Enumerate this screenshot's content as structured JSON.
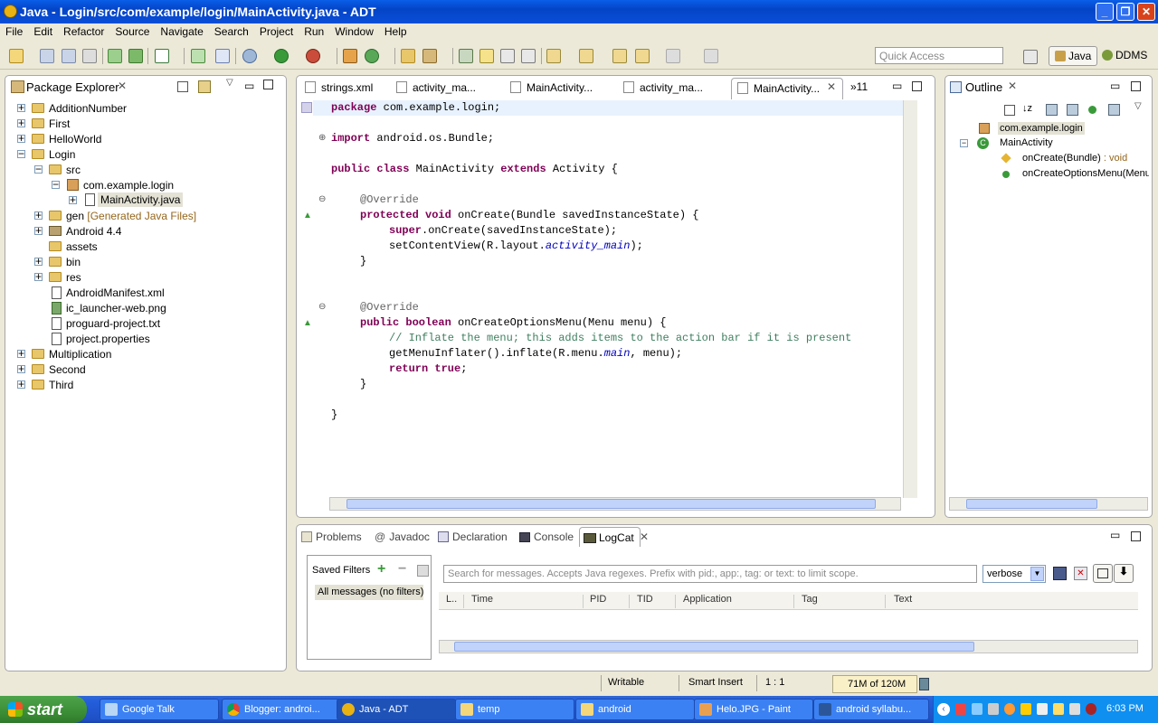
{
  "window": {
    "title": "Java - Login/src/com/example/login/MainActivity.java - ADT"
  },
  "menu": [
    "File",
    "Edit",
    "Refactor",
    "Source",
    "Navigate",
    "Search",
    "Project",
    "Run",
    "Window",
    "Help"
  ],
  "quick_access": {
    "placeholder": "Quick Access"
  },
  "perspectives": {
    "java": "Java",
    "ddms": "DDMS"
  },
  "package_explorer": {
    "title": "Package Explorer",
    "items": {
      "additionnumber": "AdditionNumber",
      "first": "First",
      "helloworld": "HelloWorld",
      "login": "Login",
      "src": "src",
      "package": "com.example.login",
      "mainactivity": "MainActivity.java",
      "gen": "gen",
      "gen_note": "[Generated Java Files]",
      "android": "Android 4.4",
      "assets": "assets",
      "bin": "bin",
      "res": "res",
      "manifest": "AndroidManifest.xml",
      "launcher": "ic_launcher-web.png",
      "proguard": "proguard-project.txt",
      "properties": "project.properties",
      "multiplication": "Multiplication",
      "second": "Second",
      "third": "Third"
    }
  },
  "editor": {
    "tabs": [
      "strings.xml",
      "activity_ma...",
      "MainActivity...",
      "activity_ma...",
      "MainActivity..."
    ],
    "overflow": "»11",
    "code": {
      "l1_kw": "package",
      "l1_rest": " com.example.login;",
      "l2_kw": "import",
      "l2_rest": " android.os.Bundle;",
      "l3_kw1": "public class",
      "l3_mid": " MainActivity ",
      "l3_kw2": "extends",
      "l3_rest": " Activity {",
      "l4_ann": "@Override",
      "l5_kw": "protected void",
      "l5_rest": " onCreate(Bundle savedInstanceState) {",
      "l6_kw": "super",
      "l6_rest": ".onCreate(savedInstanceState);",
      "l7_a": "setContentView(R.layout.",
      "l7_it": "activity_main",
      "l7_b": ");",
      "l8": "}",
      "l9_ann": "@Override",
      "l10_kw": "public boolean",
      "l10_rest": " onCreateOptionsMenu(Menu menu) {",
      "l11_cmt": "// Inflate the menu; this adds items to the action bar if it is present",
      "l12_a": "getMenuInflater().inflate(R.menu.",
      "l12_it": "main",
      "l12_b": ", menu);",
      "l13_kw": "return true",
      "l13_rest": ";",
      "l14": "}",
      "l15": "}"
    }
  },
  "outline": {
    "title": "Outline",
    "package": "com.example.login",
    "class": "MainActivity",
    "method1": "onCreate(Bundle)",
    "method1_type": " : void",
    "method2": "onCreateOptionsMenu(Menu"
  },
  "bottom_tabs": {
    "problems": "Problems",
    "javadoc": "Javadoc",
    "declaration": "Declaration",
    "console": "Console",
    "logcat": "LogCat"
  },
  "logcat": {
    "saved_filters": "Saved Filters",
    "all_messages": "All messages (no filters)",
    "search_placeholder": "Search for messages. Accepts Java regexes. Prefix with pid:, app:, tag: or text: to limit scope.",
    "level": "verbose",
    "columns": [
      "L..",
      "Time",
      "PID",
      "TID",
      "Application",
      "Tag",
      "Text"
    ]
  },
  "status": {
    "writable": "Writable",
    "insert": "Smart Insert",
    "position": "1 : 1",
    "heap": "71M of 120M"
  },
  "taskbar": {
    "start": "start",
    "items": [
      "Google Talk",
      "Blogger: androi...",
      "Java - ADT",
      "temp",
      "android",
      "Helo.JPG - Paint",
      "android syllabu..."
    ],
    "clock": "6:03 PM"
  }
}
